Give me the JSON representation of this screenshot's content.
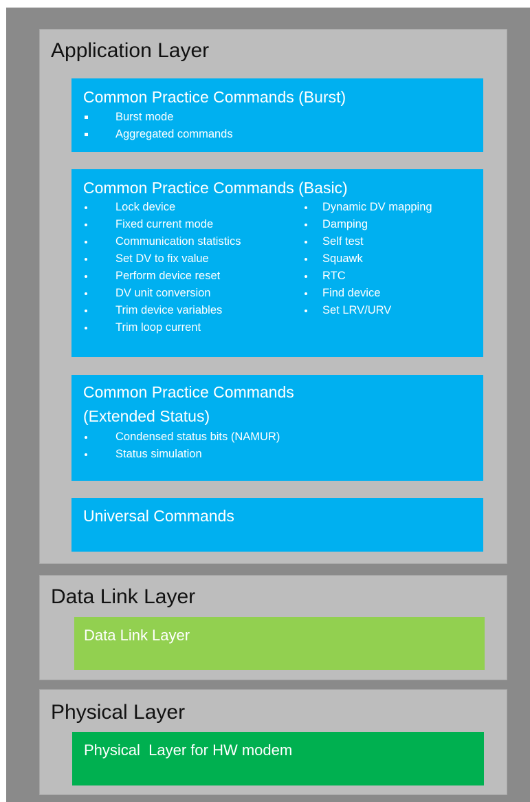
{
  "application_layer": {
    "title": "Application Layer",
    "burst": {
      "title": "Common Practice Commands (Burst)",
      "items": [
        "Burst mode",
        "Aggregated commands"
      ]
    },
    "basic": {
      "title": "Common Practice Commands (Basic)",
      "left_items": [
        "Lock device",
        "Fixed current mode",
        "Communication statistics",
        "Set DV to fix value",
        "Perform device reset",
        "DV unit conversion",
        "Trim device variables",
        "Trim loop current"
      ],
      "right_items": [
        "Dynamic DV mapping",
        "Damping",
        "Self test",
        "Squawk",
        "RTC",
        "Find device",
        "Set LRV/URV"
      ]
    },
    "extended": {
      "title_line1": "Common Practice Commands",
      "title_line2": "(Extended Status)",
      "items": [
        "Condensed status bits (NAMUR)",
        "Status simulation"
      ]
    },
    "universal": {
      "title": "Universal Commands"
    }
  },
  "data_link_layer": {
    "title": "Data Link Layer",
    "box_title": "Data Link Layer"
  },
  "physical_layer": {
    "title": "Physical Layer",
    "box_title": "Physical  Layer for HW modem"
  },
  "colors": {
    "frame": "#8a8a8a",
    "layer": "#bdbdbd",
    "blue": "#00b0f0",
    "light_green": "#92d050",
    "dark_green": "#00b050"
  }
}
